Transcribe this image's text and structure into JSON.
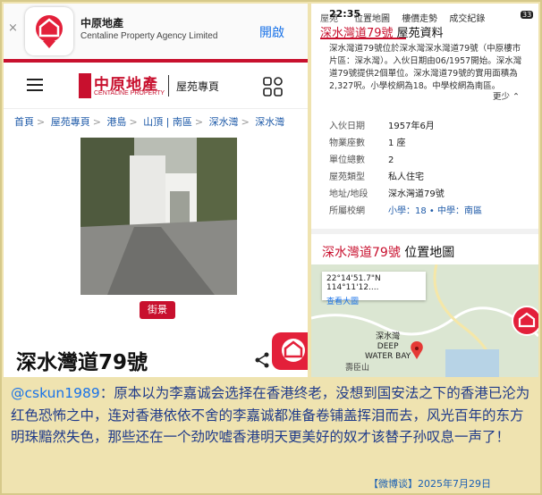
{
  "left": {
    "app_banner": {
      "close": "×",
      "name": "中原地產",
      "subtitle": "Centaline Property Agency Limited",
      "open_label": "開啟"
    },
    "header": {
      "brand_cn": "中原地產",
      "brand_en": "CENTALINE PROPERTY",
      "section": "屋苑專頁"
    },
    "breadcrumb": [
      "首頁",
      "屋苑專頁",
      "港島",
      "山頂 | 南區",
      "深水灣",
      "深水灣"
    ],
    "breadcrumb_sep": ">",
    "photo_tag": "街景",
    "property_title": "深水灣道79號"
  },
  "right": {
    "status": {
      "carrier": "屋苑",
      "time": "22:35",
      "nav": [
        "位置地圖",
        "樓價走勢",
        "成交紀錄"
      ],
      "battery": "33"
    },
    "section_title_red": "深水灣道79號",
    "section_title_rest": " 屋苑資料",
    "description": "深水灣道79號位於深水灣深水灣道79號（中原樓市片區：深水灣）。入伙日期由06/1957開始。深水灣道79號提供2個單位。深水灣道79號的實用面積為2,327呎。小學校網為18。中學校網為南區。",
    "more": "更少 ⌃",
    "info_rows": [
      {
        "k": "入伙日期",
        "v": "1957年6月"
      },
      {
        "k": "物業座數",
        "v": "1 座"
      },
      {
        "k": "單位總數",
        "v": "2"
      },
      {
        "k": "屋苑類型",
        "v": "私人住宅"
      },
      {
        "k": "地址/地段",
        "v": "深水灣道79號"
      },
      {
        "k": "所屬校網",
        "v": "小學：18 • 中學：南區",
        "link": true
      }
    ],
    "map_title_red": "深水灣道79號",
    "map_title_rest": " 位置地圖",
    "map": {
      "coord": "22°14'51.7\"N 114°11'12....",
      "view_larger": "查看大圖",
      "place_label": "DEEP\nWATER BAY",
      "place_cn": "深水灣",
      "hill_label": "壽臣山"
    }
  },
  "caption": {
    "user": "@cskun1989",
    "text": "：原本以为李嘉诚会选择在香港终老，没想到国安法之下的香港已沦为红色恐怖之中，连对香港依依不舍的李嘉诚都准备卷铺盖挥泪而去，风光百年的东方明珠黯然失色，那些还在一个劲吹嘘香港明天更美好的奴才该替子孙叹息一声了！"
  },
  "source": "【微博谈】2025年7月29日",
  "colors": {
    "brand_red": "#c8102e",
    "link_blue": "#1e5aa8",
    "caption_blue": "#1f3a8a",
    "background": "#efe3b0"
  }
}
